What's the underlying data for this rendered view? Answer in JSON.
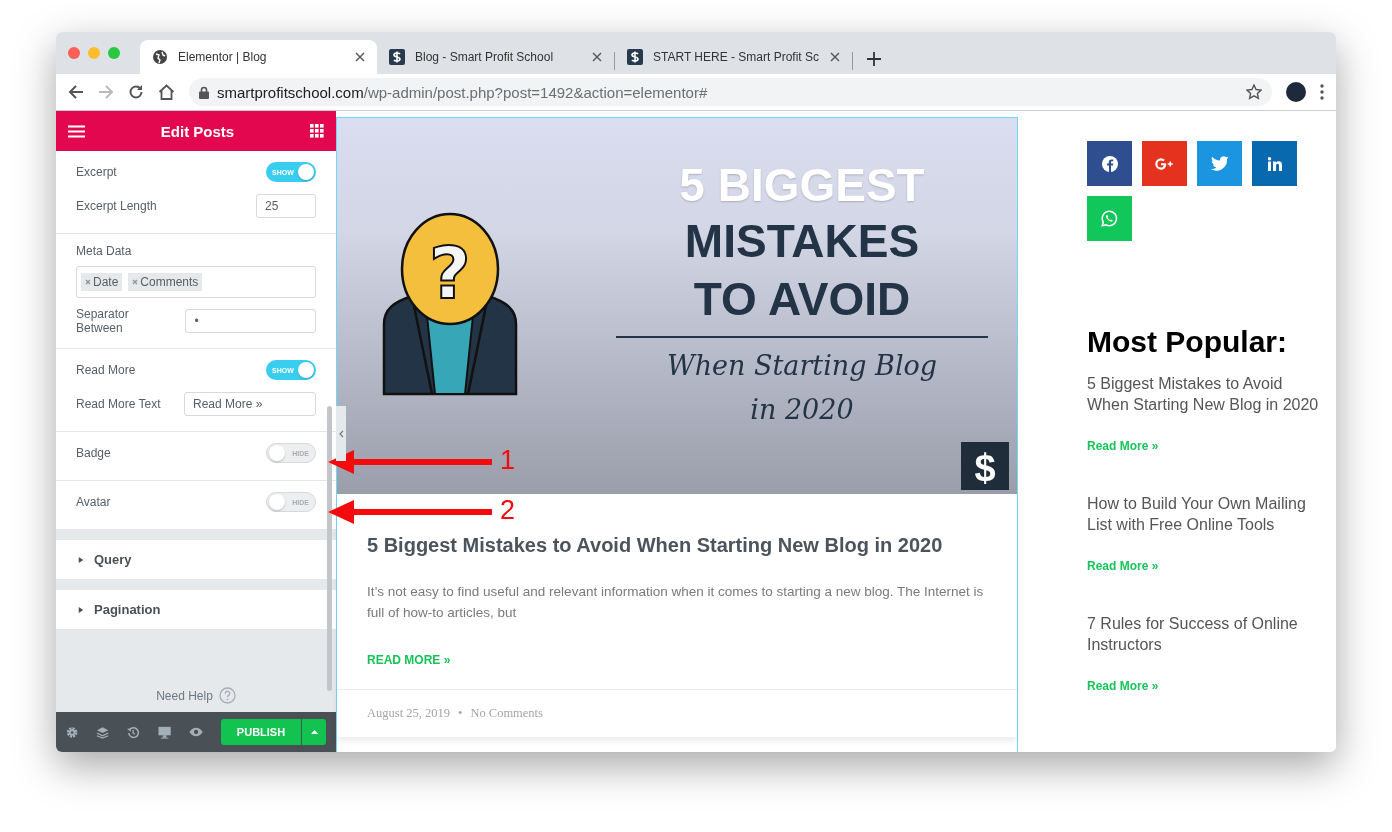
{
  "browser": {
    "tabs": [
      {
        "title": "Elementor | Blog",
        "kind": "globe",
        "selected": true
      },
      {
        "title": "Blog - Smart Profit School",
        "kind": "dollar",
        "selected": false
      },
      {
        "title": "START HERE - Smart Profit Sc",
        "kind": "dollar",
        "selected": false
      }
    ],
    "url_host": "smartprofitschool.com",
    "url_path": "/wp-admin/post.php?post=1492&action=elementor#"
  },
  "panel": {
    "title": "Edit Posts",
    "sections": [
      {
        "controls": [
          {
            "kind": "toggle",
            "label": "Excerpt",
            "on": true,
            "toggle_text": "SHOW"
          },
          {
            "kind": "number",
            "label": "Excerpt Length",
            "value": "25"
          }
        ]
      },
      {
        "controls": [
          {
            "kind": "tags",
            "label": "Meta Data",
            "tags": [
              "Date",
              "Comments"
            ]
          },
          {
            "kind": "text",
            "label": "Separator Between",
            "value": "•"
          }
        ]
      },
      {
        "controls": [
          {
            "kind": "toggle",
            "label": "Read More",
            "on": true,
            "toggle_text": "SHOW"
          },
          {
            "kind": "text",
            "label": "Read More Text",
            "value": "Read More »"
          }
        ]
      },
      {
        "controls": [
          {
            "kind": "toggle",
            "label": "Badge",
            "on": false,
            "toggle_text": "HIDE"
          }
        ]
      },
      {
        "controls": [
          {
            "kind": "toggle",
            "label": "Avatar",
            "on": false,
            "toggle_text": "HIDE"
          }
        ]
      }
    ],
    "collapsed_sections": [
      {
        "label": "Query",
        "expanded": false
      },
      {
        "label": "Pagination",
        "expanded": false
      }
    ],
    "help": "Need Help",
    "publish": "PUBLISH"
  },
  "post": {
    "image": {
      "line1": "5 BIGGEST",
      "line2": "MISTAKES",
      "line3": "TO AVOID",
      "script1": "When Starting Blog",
      "script2": "in 2020",
      "mark": "?",
      "logo": "$"
    },
    "title": "5 Biggest Mistakes to Avoid When Starting New Blog in 2020",
    "excerpt": "It’s not easy to find useful and relevant information when it comes to starting a new blog. The Internet is full of how-to articles, but",
    "read_more": "READ MORE »",
    "date": "August 25, 2019",
    "separator": "•",
    "comments": "No Comments"
  },
  "sidebar": {
    "social": [
      {
        "kind": "facebook",
        "color": "#2f4e8f"
      },
      {
        "kind": "googleplus",
        "color": "#e4321e"
      },
      {
        "kind": "twitter",
        "color": "#1b95e0"
      },
      {
        "kind": "linkedin",
        "color": "#0869ae"
      },
      {
        "kind": "whatsapp",
        "color": "#12c75a"
      }
    ],
    "heading": "Most Popular:",
    "items": [
      {
        "title": "5 Biggest Mistakes to Avoid When Starting New Blog in 2020",
        "link": "Read More »"
      },
      {
        "title": "How to Build Your Own Mailing List with Free Online Tools",
        "link": "Read More »"
      },
      {
        "title": "7 Rules for Success of Online Instructors",
        "link": "Read More »"
      }
    ]
  },
  "annotations": [
    {
      "label": "1"
    },
    {
      "label": "2"
    }
  ]
}
